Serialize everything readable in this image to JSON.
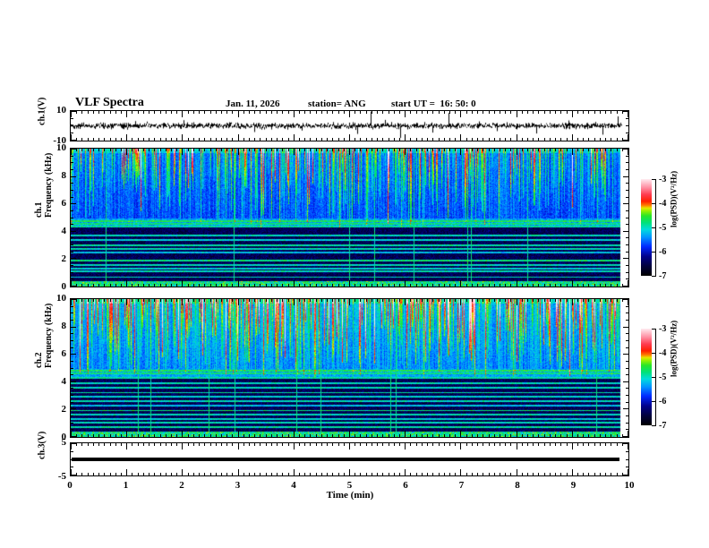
{
  "header": {
    "title": "VLF Spectra",
    "date": "Jan. 11, 2026",
    "station": "station= ANG",
    "start_ut": "start UT =  16: 50: 0"
  },
  "axes": {
    "time": {
      "label": "Time (min)",
      "min": 0,
      "max": 10,
      "major_step": 1,
      "minor_step": 0.1,
      "tick_labels": [
        "0",
        "1",
        "2",
        "3",
        "4",
        "5",
        "6",
        "7",
        "8",
        "9",
        "10"
      ]
    },
    "freq": {
      "label": "Frequency (kHz)",
      "min": 0,
      "max": 10,
      "major_step": 2,
      "minor_step": 0.5,
      "tick_labels": [
        "0",
        "2",
        "4",
        "6",
        "8",
        "10"
      ]
    },
    "ch1_volts": {
      "label": "ch.1(V)",
      "min": -10,
      "max": 10,
      "tick_labels": [
        "10",
        "-10"
      ]
    },
    "ch3_volts": {
      "label": "ch.3(V)",
      "min": -5,
      "max": 5,
      "tick_labels": [
        "5",
        "-5"
      ]
    },
    "ch1_line": "ch.1",
    "ch2_line": "ch.2"
  },
  "colorbar": {
    "label": "log(PSD)(V²/Hz)",
    "min": -7,
    "max": -3,
    "tick_labels": [
      "-3",
      "-4",
      "-5",
      "-6",
      "-7"
    ],
    "stops": [
      [
        "0%",
        "#000000"
      ],
      [
        "10%",
        "#00003c"
      ],
      [
        "20%",
        "#00008c"
      ],
      [
        "30%",
        "#0028ff"
      ],
      [
        "40%",
        "#0096ff"
      ],
      [
        "48%",
        "#00dcdc"
      ],
      [
        "55%",
        "#00e178"
      ],
      [
        "62%",
        "#28e628"
      ],
      [
        "67%",
        "#96f000"
      ],
      [
        "70%",
        "#e6e600"
      ],
      [
        "73%",
        "#ff7800"
      ],
      [
        "77%",
        "#ff1e00"
      ],
      [
        "84%",
        "#ff3c50"
      ],
      [
        "91%",
        "#ff8ca0"
      ],
      [
        "100%",
        "#ffebf0"
      ]
    ]
  },
  "chart_data": [
    {
      "id": "ch1_waveform",
      "type": "line",
      "ylabel": "ch.1(V)",
      "xlabel": "Time (min)",
      "xlim": [
        0,
        10
      ],
      "ylim": [
        -10,
        10
      ],
      "description": "broadband noise of ~±2 V about 0 V with transient spikes",
      "noise_amplitude_v": 2.0,
      "seed": 42,
      "data_end_min": 9.86,
      "spikes_t_v": [
        [
          1.15,
          3.2
        ],
        [
          2.02,
          3.8
        ],
        [
          3.28,
          -4.2
        ],
        [
          4.12,
          -3.2
        ],
        [
          5.12,
          -5.5
        ],
        [
          5.36,
          9.6
        ],
        [
          5.62,
          4.0
        ],
        [
          5.88,
          -8.2
        ],
        [
          6.47,
          -4.6
        ],
        [
          6.75,
          8.8
        ],
        [
          7.3,
          3.0
        ],
        [
          7.62,
          -3.6
        ],
        [
          8.32,
          -5.2
        ],
        [
          8.9,
          3.6
        ],
        [
          9.5,
          -6.0
        ],
        [
          9.78,
          6.4
        ]
      ]
    },
    {
      "id": "ch1_spectrogram",
      "type": "heatmap",
      "ylabel": "Frequency (kHz)",
      "xlabel": "Time (min)",
      "zlabel": "log(PSD)(V²/Hz)",
      "xlim": [
        0,
        10
      ],
      "ylim": [
        0,
        10
      ],
      "zlim": [
        -7,
        -3
      ],
      "description": "VLF spectrogram: blue/cyan background above ~5 kHz with dense vertical impulsive streaks (green/yellow/red), bright cyan band 4.3-5 kHz, dark region below 4.3 kHz crossed by narrow green horizontal tone lines, bright speckled row near 0 kHz",
      "seed": 1234,
      "data_end_min": 9.82,
      "upper_base": 0.31,
      "streak_prob": 0.3,
      "strong_streak_prob": 0.06,
      "hot_prob": 0.055,
      "horizontal_lines_khz": [
        [
          4.75,
          0.58
        ],
        [
          4.55,
          0.55
        ],
        [
          4.35,
          0.52
        ],
        [
          3.7,
          0.5
        ],
        [
          3.35,
          0.48
        ],
        [
          3.0,
          0.52
        ],
        [
          2.7,
          0.5
        ],
        [
          2.45,
          0.45
        ],
        [
          1.85,
          0.55
        ],
        [
          1.55,
          0.5
        ],
        [
          1.25,
          0.48
        ],
        [
          1.1,
          0.5
        ],
        [
          0.65,
          0.5
        ]
      ]
    },
    {
      "id": "ch2_spectrogram",
      "type": "heatmap",
      "ylabel": "Frequency (kHz)",
      "xlabel": "Time (min)",
      "zlabel": "log(PSD)(V²/Hz)",
      "xlim": [
        0,
        10
      ],
      "ylim": [
        0,
        10
      ],
      "zlim": [
        -7,
        -3
      ],
      "description": "same as ch.1 but overall brighter: green-dominated upper half with frequent orange/red streaks",
      "seed": 5678,
      "data_end_min": 9.82,
      "upper_base": 0.37,
      "streak_prob": 0.34,
      "strong_streak_prob": 0.09,
      "hot_prob": 0.1,
      "horizontal_lines_khz": [
        [
          4.8,
          0.58
        ],
        [
          4.6,
          0.55
        ],
        [
          4.3,
          0.52
        ],
        [
          3.9,
          0.5
        ],
        [
          3.55,
          0.5
        ],
        [
          3.2,
          0.52
        ],
        [
          2.9,
          0.48
        ],
        [
          2.6,
          0.5
        ],
        [
          2.25,
          0.45
        ],
        [
          1.9,
          0.55
        ],
        [
          1.6,
          0.5
        ],
        [
          1.3,
          0.48
        ],
        [
          1.0,
          0.5
        ],
        [
          0.7,
          0.52
        ]
      ]
    },
    {
      "id": "ch3_waveform",
      "type": "line",
      "ylabel": "ch.3(V)",
      "xlabel": "Time (min)",
      "xlim": [
        0,
        10
      ],
      "ylim": [
        -5,
        5
      ],
      "description": "constant flat trace at 0 V (thick black line)",
      "constant_value_v": 0,
      "data_end_min": 9.82
    }
  ]
}
